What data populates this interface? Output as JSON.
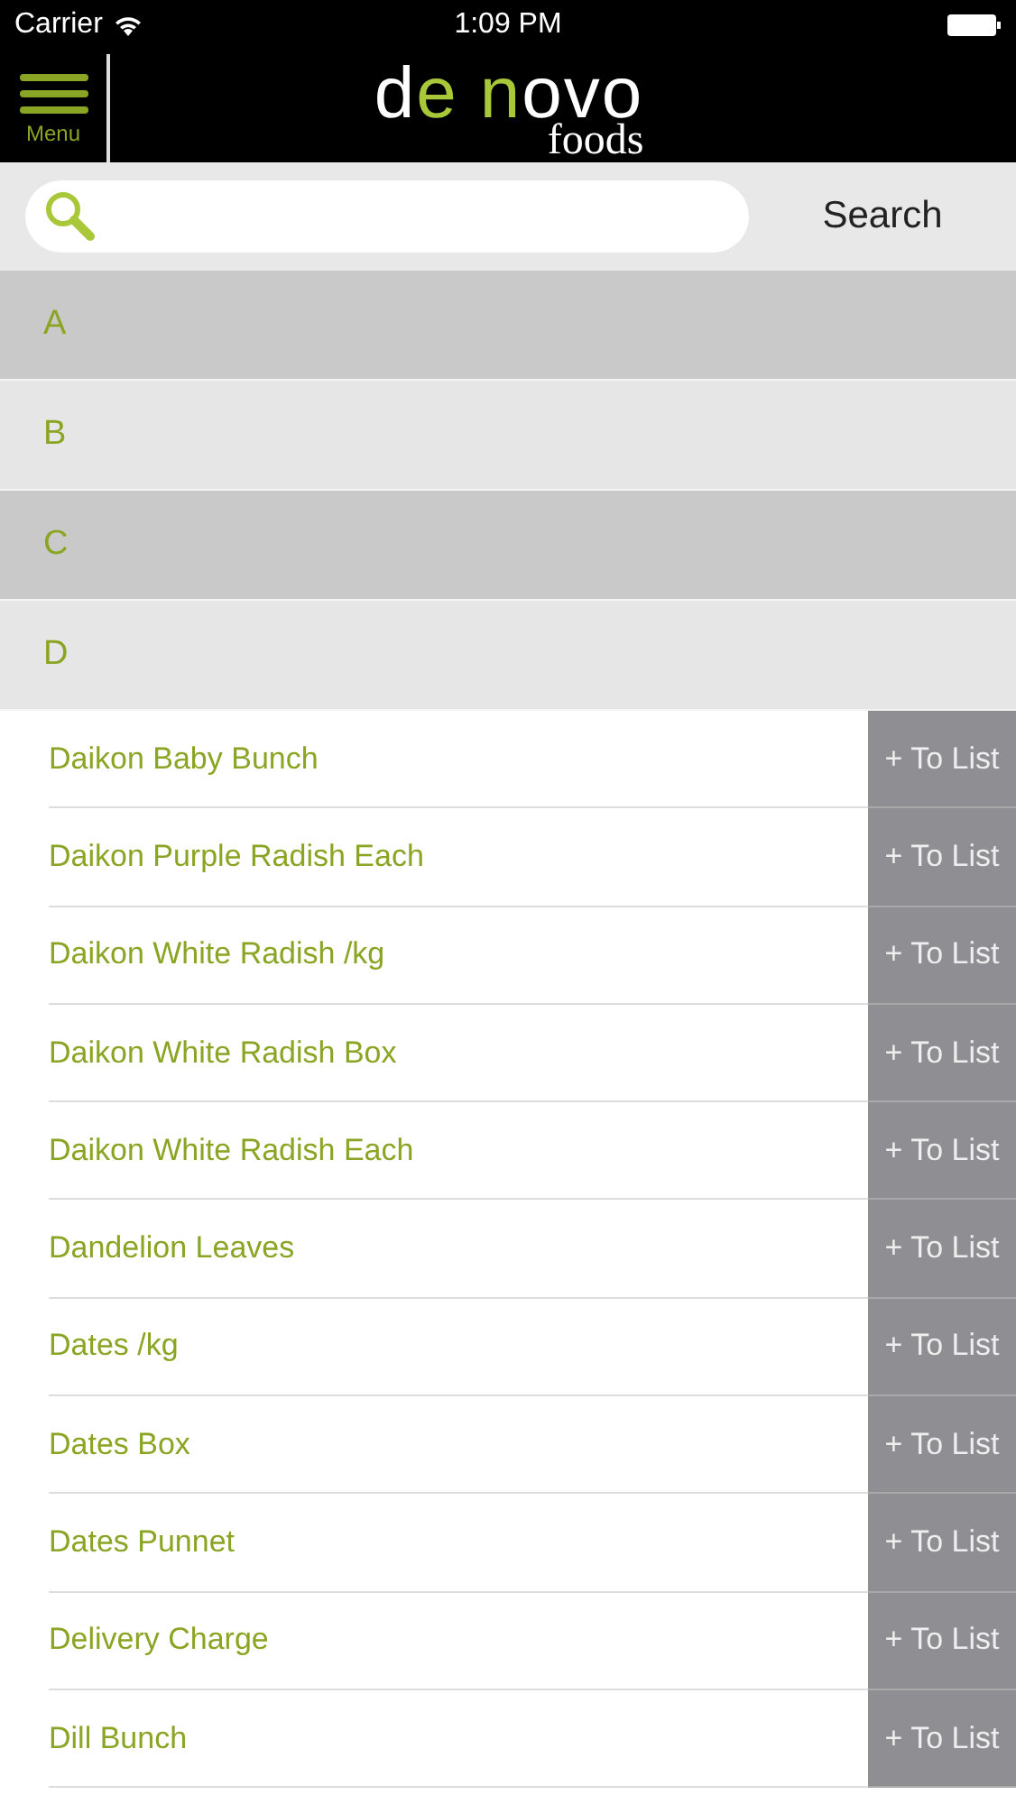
{
  "status_bar": {
    "carrier": "Carrier",
    "time": "1:09 PM"
  },
  "header": {
    "menu_label": "Menu",
    "logo_parts": [
      {
        "text": "d",
        "accent": false
      },
      {
        "text": "e",
        "accent": true
      },
      {
        "text": " n",
        "accent": true
      },
      {
        "text": "ovo",
        "accent": false
      }
    ],
    "logo_subtitle": "foods"
  },
  "search": {
    "button": "Search"
  },
  "sections": [
    {
      "letter": "A"
    },
    {
      "letter": "B"
    },
    {
      "letter": "C"
    },
    {
      "letter": "D",
      "items": [
        {
          "name": "Daikon Baby Bunch",
          "action": "+ To List"
        },
        {
          "name": "Daikon Purple Radish Each",
          "action": "+ To List"
        },
        {
          "name": "Daikon White Radish /kg",
          "action": "+ To List"
        },
        {
          "name": "Daikon White Radish Box",
          "action": "+ To List"
        },
        {
          "name": "Daikon White Radish Each",
          "action": "+ To List"
        },
        {
          "name": "Dandelion Leaves",
          "action": "+ To List"
        },
        {
          "name": "Dates /kg",
          "action": "+ To List"
        },
        {
          "name": "Dates Box",
          "action": "+ To List"
        },
        {
          "name": "Dates Punnet",
          "action": "+ To List"
        },
        {
          "name": "Delivery Charge",
          "action": "+ To List"
        },
        {
          "name": "Dill Bunch",
          "action": "+ To List"
        }
      ]
    }
  ]
}
